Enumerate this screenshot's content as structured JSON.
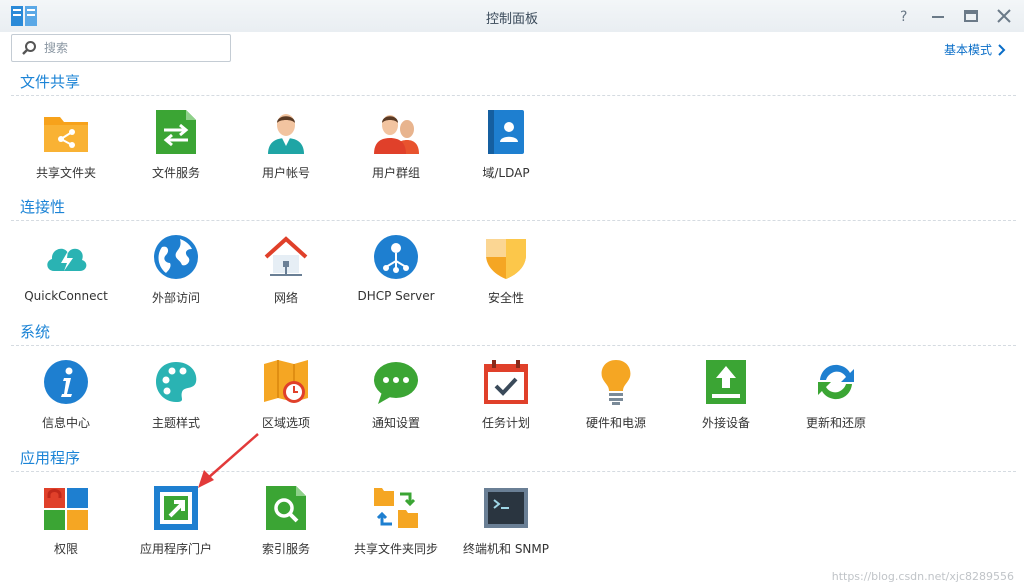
{
  "window": {
    "title": "控制面板",
    "controls": [
      "help-icon",
      "minimize-icon",
      "maximize-icon",
      "close-icon"
    ]
  },
  "search": {
    "placeholder": "搜索",
    "value": ""
  },
  "mode_link": {
    "label": "基本模式"
  },
  "colors": {
    "accent": "#1c84d6",
    "link": "#0a6ec8",
    "annotation_arrow": "#e23a3a"
  },
  "sections": [
    {
      "title": "文件共享",
      "items": [
        {
          "label": "共享文件夹",
          "icon": "shared-folder-icon"
        },
        {
          "label": "文件服务",
          "icon": "file-services-icon"
        },
        {
          "label": "用户帐号",
          "icon": "user-icon"
        },
        {
          "label": "用户群组",
          "icon": "group-icon"
        },
        {
          "label": "域/LDAP",
          "icon": "domain-ldap-icon"
        }
      ]
    },
    {
      "title": "连接性",
      "items": [
        {
          "label": "QuickConnect",
          "icon": "quickconnect-icon"
        },
        {
          "label": "外部访问",
          "icon": "external-access-icon"
        },
        {
          "label": "网络",
          "icon": "network-icon"
        },
        {
          "label": "DHCP Server",
          "icon": "dhcp-server-icon"
        },
        {
          "label": "安全性",
          "icon": "security-icon"
        }
      ]
    },
    {
      "title": "系统",
      "items": [
        {
          "label": "信息中心",
          "icon": "info-center-icon"
        },
        {
          "label": "主题样式",
          "icon": "theme-icon"
        },
        {
          "label": "区域选项",
          "icon": "regional-options-icon"
        },
        {
          "label": "通知设置",
          "icon": "notification-icon"
        },
        {
          "label": "任务计划",
          "icon": "task-scheduler-icon"
        },
        {
          "label": "硬件和电源",
          "icon": "hardware-power-icon"
        },
        {
          "label": "外接设备",
          "icon": "external-devices-icon"
        },
        {
          "label": "更新和还原",
          "icon": "update-restore-icon"
        }
      ]
    },
    {
      "title": "应用程序",
      "items": [
        {
          "label": "权限",
          "icon": "privileges-icon"
        },
        {
          "label": "应用程序门户",
          "icon": "application-portal-icon"
        },
        {
          "label": "索引服务",
          "icon": "indexing-service-icon"
        },
        {
          "label": "共享文件夹同步",
          "icon": "shared-folder-sync-icon"
        },
        {
          "label": "终端机和 SNMP",
          "icon": "terminal-snmp-icon"
        }
      ]
    }
  ],
  "watermark": "https://blog.csdn.net/xjc8289556"
}
